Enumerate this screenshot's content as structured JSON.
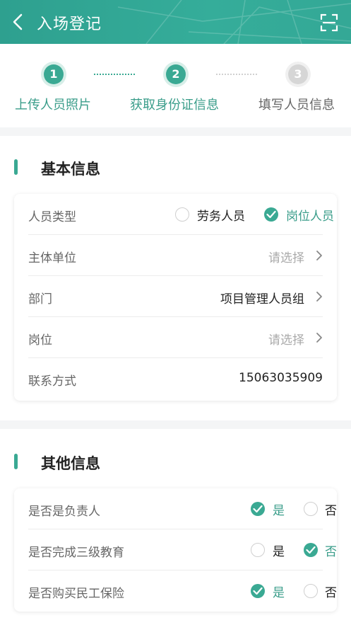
{
  "header": {
    "title": "入场登记",
    "background": "#33a692"
  },
  "steps": [
    {
      "number": "1",
      "label": "上传人员照片",
      "state": "active"
    },
    {
      "number": "2",
      "label": "获取身份证信息",
      "state": "active"
    },
    {
      "number": "3",
      "label": "填写人员信息",
      "state": "inactive"
    }
  ],
  "basic_info": {
    "title": "基本信息",
    "person_type": {
      "label": "人员类型",
      "options": [
        {
          "label": "劳务人员",
          "checked": false
        },
        {
          "label": "岗位人员",
          "checked": true
        }
      ]
    },
    "entity": {
      "label": "主体单位",
      "value": "请选择"
    },
    "department": {
      "label": "部门",
      "value": "项目管理人员组"
    },
    "position": {
      "label": "岗位",
      "value": "请选择"
    },
    "contact": {
      "label": "联系方式",
      "value": "15063035909"
    }
  },
  "other_info": {
    "title": "其他信息",
    "rows": [
      {
        "label": "是否是负责人",
        "yes": "是",
        "no": "否",
        "selected": "yes"
      },
      {
        "label": "是否完成三级教育",
        "yes": "是",
        "no": "否",
        "selected": "no"
      },
      {
        "label": "是否购买民工保险",
        "yes": "是",
        "no": "否",
        "selected": "yes"
      }
    ]
  },
  "colors": {
    "accent": "#3aa993",
    "placeholder": "#aaaaaa",
    "page_background": "#f4f5f6"
  }
}
